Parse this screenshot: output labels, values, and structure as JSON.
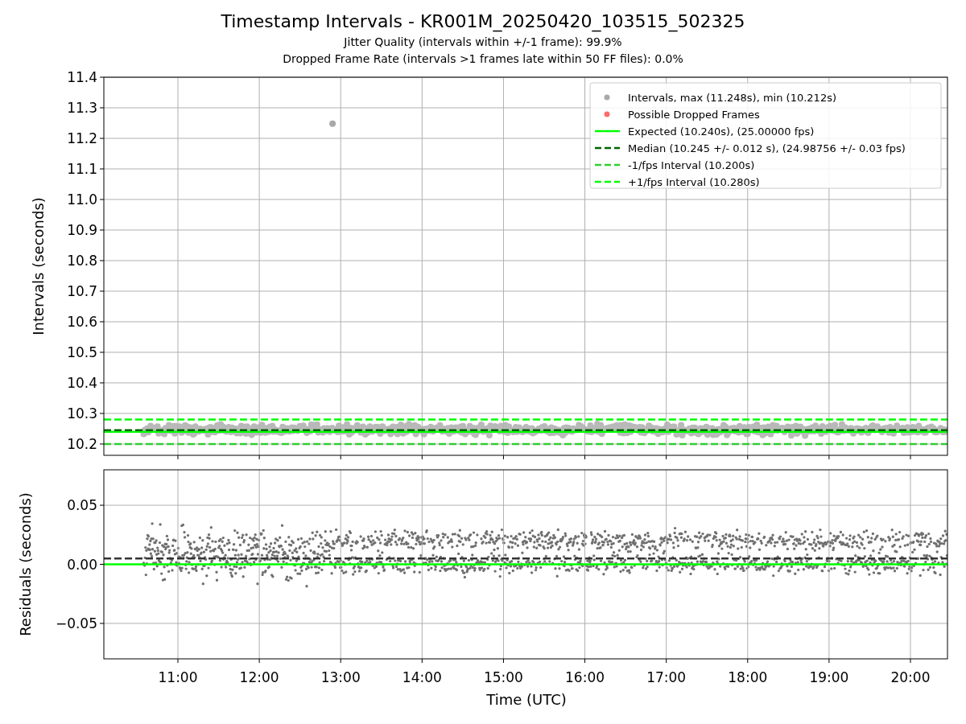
{
  "title": "Timestamp Intervals - KR001M_20250420_103515_502325",
  "subtitles": [
    "Jitter Quality (intervals within +/-1 frame): 99.9%",
    "Dropped Frame Rate (intervals >1 frames late within 50 FF files): 0.0%"
  ],
  "charts": [
    {
      "kind": "intervals",
      "chart_data": {
        "type": "scatter",
        "ylabel": "Intervals (seconds)",
        "xlim": [
          10.09,
          20.455
        ],
        "ylim": [
          10.163,
          11.4
        ],
        "grid": true,
        "legend": true,
        "x": [
          10.09,
          12.9,
          20.455
        ],
        "yticks": [
          {
            "value": 10.2,
            "label": "10.2"
          },
          {
            "value": 10.3,
            "label": "10.3"
          },
          {
            "value": 10.4,
            "label": "10.4"
          },
          {
            "value": 10.5,
            "label": "10.5"
          },
          {
            "value": 10.6,
            "label": "10.6"
          },
          {
            "value": 10.7,
            "label": "10.7"
          },
          {
            "value": 10.8,
            "label": "10.8"
          },
          {
            "value": 10.9,
            "label": "10.9"
          },
          {
            "value": 11.0,
            "label": "11.0"
          },
          {
            "value": 11.1,
            "label": "11.1"
          },
          {
            "value": 11.2,
            "label": "11.2"
          },
          {
            "value": 11.3,
            "label": "11.3"
          },
          {
            "value": 11.4,
            "label": "11.4"
          }
        ],
        "series": [
          {
            "name": "Intervals, max (11.248s), min (10.212s)",
            "type": "scatter",
            "color": "#a9a9a9",
            "values": [
              null,
              11.248,
              null
            ]
          },
          {
            "name": "Possible Dropped Frames",
            "type": "scatter",
            "color": "#ff6b6b",
            "values": [
              null,
              null,
              null
            ]
          },
          {
            "name": "Expected (10.240s), (25.00000 fps)",
            "type": "line",
            "line_style": "solid",
            "color": "#00ff00",
            "values": [
              10.24,
              10.24,
              10.24
            ]
          },
          {
            "name": "Median (10.245 +/- 0.012 s), (24.98756 +/- 0.03 fps)",
            "type": "line",
            "line_style": "dashed",
            "color": "#006400",
            "values": [
              10.245,
              10.245,
              10.245
            ]
          },
          {
            "name": "-1/fps Interval (10.200s)",
            "type": "line",
            "line_style": "dashed",
            "color": "#32cd32",
            "values": [
              10.2,
              10.2,
              10.2
            ]
          },
          {
            "name": "+1/fps Interval (10.280s)",
            "type": "line",
            "line_style": "dashed",
            "color": "#00ff00",
            "values": [
              10.28,
              10.28,
              10.28
            ]
          }
        ]
      }
    },
    {
      "kind": "residuals",
      "chart_data": {
        "type": "scatter",
        "xlabel": "Time (UTC)",
        "ylabel": "Residuals (seconds)",
        "xlim": [
          10.09,
          20.455
        ],
        "ylim": [
          -0.08,
          0.08
        ],
        "grid": true,
        "x": [
          10.09,
          20.455
        ],
        "xticks": [
          {
            "value": 11,
            "label": "11:00"
          },
          {
            "value": 12,
            "label": "12:00"
          },
          {
            "value": 13,
            "label": "13:00"
          },
          {
            "value": 14,
            "label": "14:00"
          },
          {
            "value": 15,
            "label": "15:00"
          },
          {
            "value": 16,
            "label": "16:00"
          },
          {
            "value": 17,
            "label": "17:00"
          },
          {
            "value": 18,
            "label": "18:00"
          },
          {
            "value": 19,
            "label": "19:00"
          },
          {
            "value": 20,
            "label": "20:00"
          }
        ],
        "yticks": [
          {
            "value": 0.05,
            "label": "0.05"
          },
          {
            "value": 0,
            "label": "0.00"
          },
          {
            "value": -0.05,
            "label": "−0.05"
          }
        ],
        "series": [
          {
            "type": "line",
            "line_style": "dashed",
            "color": "#333333",
            "values": [
              0.005,
              0.005
            ]
          },
          {
            "type": "line",
            "line_style": "solid",
            "color": "#00ff00",
            "values": [
              0,
              0
            ]
          }
        ]
      }
    }
  ]
}
